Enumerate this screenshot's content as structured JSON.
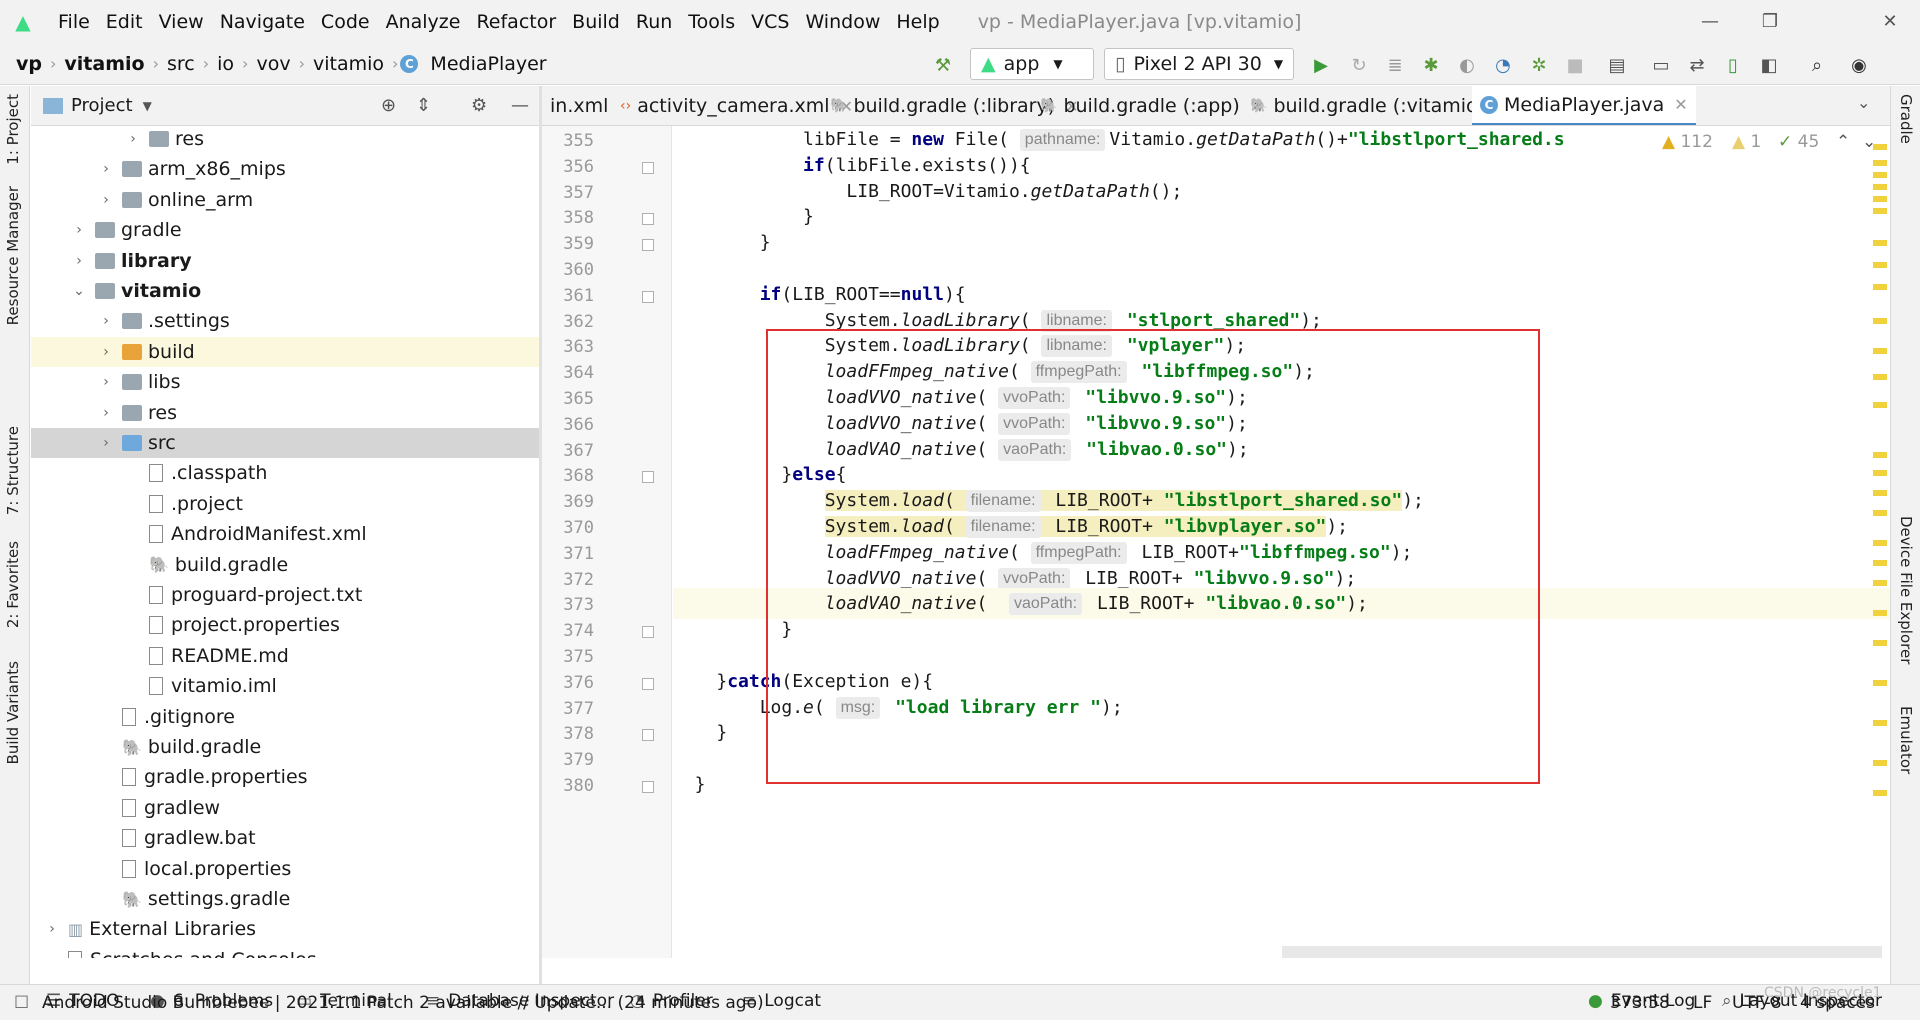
{
  "menu": {
    "items": [
      "File",
      "Edit",
      "View",
      "Navigate",
      "Code",
      "Analyze",
      "Refactor",
      "Build",
      "Run",
      "Tools",
      "VCS",
      "Window",
      "Help"
    ],
    "title": "vp - MediaPlayer.java [vp.vitamio]"
  },
  "breadcrumb": [
    "vp",
    "vitamio",
    "src",
    "io",
    "vov",
    "vitamio",
    "MediaPlayer"
  ],
  "toolbar": {
    "config": "app",
    "device": "Pixel 2 API 30"
  },
  "left_tabs": [
    "1: Project",
    "Resource Manager",
    "7: Structure",
    "2: Favorites",
    "Build Variants"
  ],
  "right_tabs": [
    "Gradle",
    "Device File Explorer",
    "Emulator"
  ],
  "project": {
    "title": "Project",
    "tree": [
      {
        "label": "res",
        "depth": 4,
        "arrow": "›",
        "icon": "folder"
      },
      {
        "label": "arm_x86_mips",
        "depth": 3,
        "arrow": "›",
        "icon": "folder"
      },
      {
        "label": "online_arm",
        "depth": 3,
        "arrow": "›",
        "icon": "folder"
      },
      {
        "label": "gradle",
        "depth": 2,
        "arrow": "›",
        "icon": "folder"
      },
      {
        "label": "library",
        "depth": 2,
        "arrow": "›",
        "icon": "module",
        "bold": true
      },
      {
        "label": "vitamio",
        "depth": 2,
        "arrow": "⌄",
        "icon": "module",
        "bold": true
      },
      {
        "label": ".settings",
        "depth": 3,
        "arrow": "›",
        "icon": "folder"
      },
      {
        "label": "build",
        "depth": 3,
        "arrow": "›",
        "icon": "folder-orange",
        "hl": true
      },
      {
        "label": "libs",
        "depth": 3,
        "arrow": "›",
        "icon": "folder"
      },
      {
        "label": "res",
        "depth": 3,
        "arrow": "›",
        "icon": "folder"
      },
      {
        "label": "src",
        "depth": 3,
        "arrow": "›",
        "icon": "folder-blue",
        "sel": true
      },
      {
        "label": ".classpath",
        "depth": 4,
        "arrow": "",
        "icon": "file"
      },
      {
        "label": ".project",
        "depth": 4,
        "arrow": "",
        "icon": "file"
      },
      {
        "label": "AndroidManifest.xml",
        "depth": 4,
        "arrow": "",
        "icon": "file"
      },
      {
        "label": "build.gradle",
        "depth": 4,
        "arrow": "",
        "icon": "gradle"
      },
      {
        "label": "proguard-project.txt",
        "depth": 4,
        "arrow": "",
        "icon": "file"
      },
      {
        "label": "project.properties",
        "depth": 4,
        "arrow": "",
        "icon": "file"
      },
      {
        "label": "README.md",
        "depth": 4,
        "arrow": "",
        "icon": "file"
      },
      {
        "label": "vitamio.iml",
        "depth": 4,
        "arrow": "",
        "icon": "file"
      },
      {
        "label": ".gitignore",
        "depth": 3,
        "arrow": "",
        "icon": "file"
      },
      {
        "label": "build.gradle",
        "depth": 3,
        "arrow": "",
        "icon": "gradle"
      },
      {
        "label": "gradle.properties",
        "depth": 3,
        "arrow": "",
        "icon": "file"
      },
      {
        "label": "gradlew",
        "depth": 3,
        "arrow": "",
        "icon": "file"
      },
      {
        "label": "gradlew.bat",
        "depth": 3,
        "arrow": "",
        "icon": "file"
      },
      {
        "label": "local.properties",
        "depth": 3,
        "arrow": "",
        "icon": "file"
      },
      {
        "label": "settings.gradle",
        "depth": 3,
        "arrow": "",
        "icon": "gradle"
      },
      {
        "label": "External Libraries",
        "depth": 1,
        "arrow": "›",
        "icon": "lib"
      },
      {
        "label": "Scratches and Consoles",
        "depth": 1,
        "arrow": "",
        "icon": "file"
      }
    ]
  },
  "tabs": [
    "in.xml",
    "activity_camera.xml",
    "build.gradle (:library)",
    "build.gradle (:app)",
    "build.gradle (:vitamio)",
    "MediaPlayer.java"
  ],
  "inspections": {
    "warnings": "112",
    "weak": "1",
    "ok": "45"
  },
  "code": {
    "lines": [
      {
        "n": "355",
        "html": "            libFile = <span class=\"kw\">new</span> File( <span class=\"hint\">pathname:</span>Vitamio.<span class=\"it\">getDataPath</span>()+<span class=\"str\">\"libstlport_shared.s</span>"
      },
      {
        "n": "356",
        "html": "            <span class=\"kw\">if</span>(libFile.exists()){"
      },
      {
        "n": "357",
        "html": "                LIB_ROOT=Vitamio.<span class=\"it\">getDataPath</span>();"
      },
      {
        "n": "358",
        "html": "            }"
      },
      {
        "n": "359",
        "html": "        }"
      },
      {
        "n": "360",
        "html": ""
      },
      {
        "n": "361",
        "html": "        <span class=\"kw\">if</span>(LIB_ROOT==<span class=\"kw\">null</span>){"
      },
      {
        "n": "362",
        "html": "              System.<span class=\"it\">loadLibrary</span>( <span class=\"hint\">libname:</span> <span class=\"str\">\"stlport_shared\"</span>);"
      },
      {
        "n": "363",
        "html": "              System.<span class=\"it\">loadLibrary</span>( <span class=\"hint\">libname:</span> <span class=\"str\">\"vplayer\"</span>);"
      },
      {
        "n": "364",
        "html": "              <span class=\"it\">loadFFmpeg_native</span>( <span class=\"hint\">ffmpegPath:</span> <span class=\"str\">\"libffmpeg.so\"</span>);"
      },
      {
        "n": "365",
        "html": "              <span class=\"it\">loadVVO_native</span>( <span class=\"hint\">vvoPath:</span> <span class=\"str\">\"libvvo.9.so\"</span>);"
      },
      {
        "n": "366",
        "html": "              <span class=\"it\">loadVVO_native</span>( <span class=\"hint\">vvoPath:</span> <span class=\"str\">\"libvvo.9.so\"</span>);"
      },
      {
        "n": "367",
        "html": "              <span class=\"it\">loadVAO_native</span>( <span class=\"hint\">vaoPath:</span> <span class=\"str\">\"libvao.0.so\"</span>);"
      },
      {
        "n": "368",
        "html": "          }<span class=\"kw\">else</span>{"
      },
      {
        "n": "369",
        "html": "              <span class=\"yel\">System.<span class=\"it\">load</span>( <span class=\"hint\">filename:</span> LIB_ROOT+ <span class=\"str\">\"libstlport_shared.so\"</span></span>);"
      },
      {
        "n": "370",
        "html": "              <span class=\"yel\">System.<span class=\"it\">load</span>( <span class=\"hint\">filename:</span> LIB_ROOT+ <span class=\"str\">\"libvplayer.so\"</span></span>);"
      },
      {
        "n": "371",
        "html": "              <span class=\"it\">loadFFmpeg_native</span>( <span class=\"hint\">ffmpegPath:</span> LIB_ROOT+<span class=\"str\">\"libffmpeg.so\"</span>);"
      },
      {
        "n": "372",
        "html": "              <span class=\"it\">loadVVO_native</span>( <span class=\"hint\">vvoPath:</span> LIB_ROOT+ <span class=\"str\">\"libvvo.9.so\"</span>);"
      },
      {
        "n": "373",
        "html": "              <span class=\"it\">loadVAO_native</span>(  <span class=\"hint\">vaoPath:</span> LIB_ROOT+ <span class=\"str\">\"libvao.0.so\"</span>);",
        "cur": true
      },
      {
        "n": "374",
        "html": "          }"
      },
      {
        "n": "375",
        "html": ""
      },
      {
        "n": "376",
        "html": "    }<span class=\"kw\">catch</span>(Exception e){"
      },
      {
        "n": "377",
        "html": "        Log.<span class=\"it\">e</span>( <span class=\"hint\">msg:</span> <span class=\"str\">\"load library err \"</span>);"
      },
      {
        "n": "378",
        "html": "    }"
      },
      {
        "n": "379",
        "html": ""
      },
      {
        "n": "380",
        "html": "  }"
      }
    ]
  },
  "bottom_tools": [
    "TODO",
    "6: Problems",
    "Terminal",
    "Database Inspector",
    "Profiler",
    "Logcat"
  ],
  "bottom_right": [
    "Event Log",
    "Layout Inspector"
  ],
  "status": {
    "message": "Android Studio Bumblebee | 2021.1.1 Patch 2 available // Update... (24 minutes ago)",
    "position": "373:58",
    "line_sep": "LF",
    "encoding": "UTF-8",
    "indent": "4 spaces",
    "watermark": "CSDN @recycle1"
  }
}
